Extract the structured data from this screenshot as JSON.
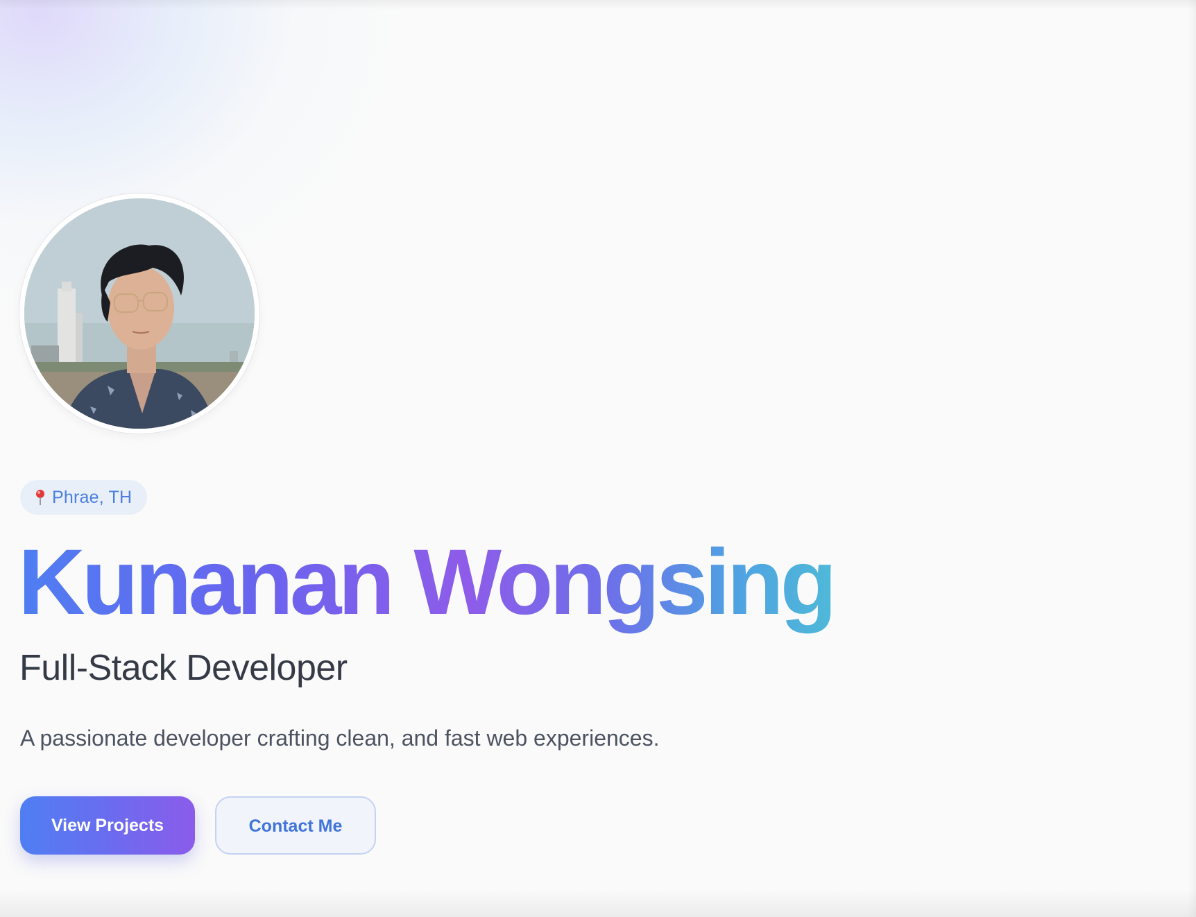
{
  "profile": {
    "photo_alt": "Profile photo of Kunanan Wongsing",
    "location": "Phrae, TH",
    "name": "Kunanan Wongsing",
    "role": "Full-Stack Developer",
    "tagline": "A passionate developer crafting clean, and fast web experiences."
  },
  "actions": {
    "primary_label": "View Projects",
    "secondary_label": "Contact Me"
  },
  "icons": {
    "location": "map-pin-icon"
  },
  "colors": {
    "accent_blue": "#4f7ef2",
    "accent_purple": "#8e5ce9",
    "accent_cyan": "#4fb9d8",
    "text_dark": "#343a46",
    "text_muted": "#4b5260",
    "page_bg": "#fafafa"
  }
}
